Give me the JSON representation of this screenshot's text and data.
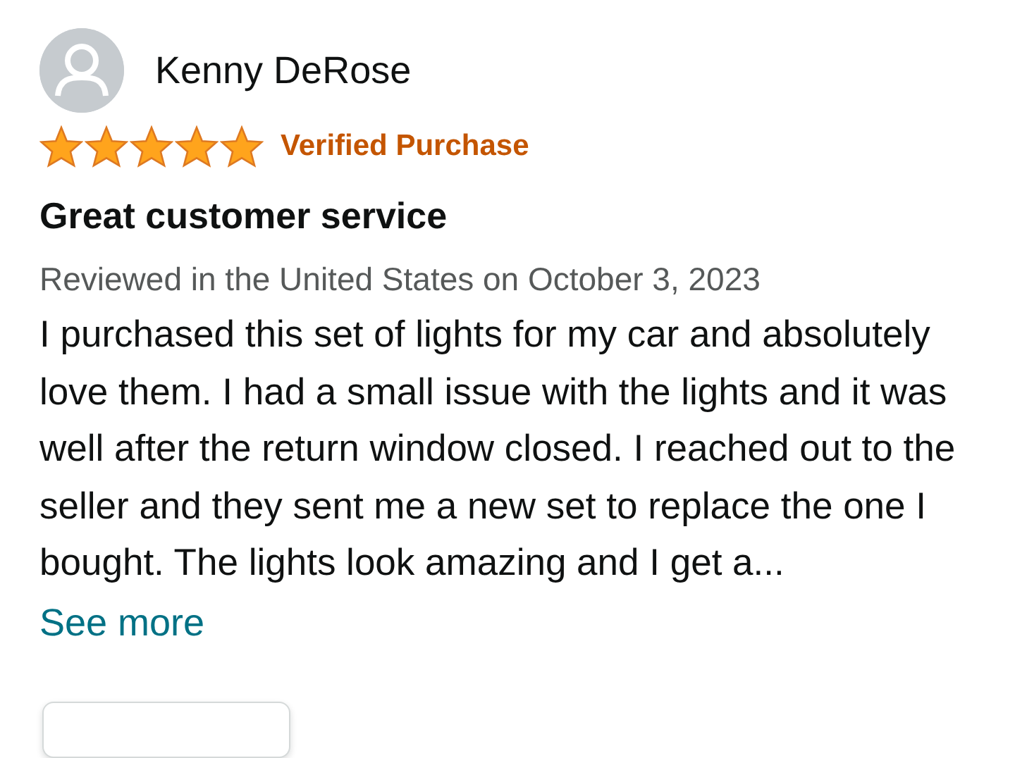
{
  "review": {
    "author": "Kenny DeRose",
    "stars": 5,
    "badge": "Verified Purchase",
    "title": "Great customer service",
    "date": "Reviewed in the United States on October 3, 2023",
    "body": "I purchased this set of lights for my car and absolutely love them. I had a small issue with the lights and it was well after the return window closed. I reached out to the seller and they sent me a new set to replace the one I bought. The lights look amazing and I get a...",
    "more_link": "See more"
  }
}
